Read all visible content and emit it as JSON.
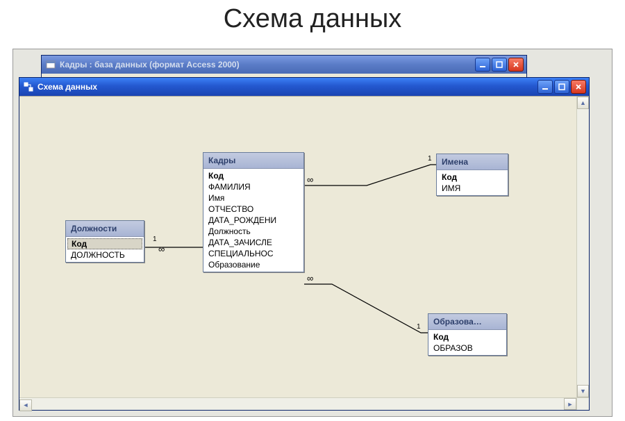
{
  "page_title": "Схема данных",
  "back_window": {
    "title": "Кадры : база данных (формат Access 2000)"
  },
  "front_window": {
    "title": "Схема данных"
  },
  "tables": {
    "dolzhnosti": {
      "title": "Должности",
      "fields": [
        "Код",
        "ДОЛЖНОСТЬ"
      ]
    },
    "kadry": {
      "title": "Кадры",
      "fields": [
        "Код",
        "ФАМИЛИЯ",
        "Имя",
        "ОТЧЕСТВО",
        "ДАТА_РОЖДЕНИ",
        "Должность",
        "ДАТА_ЗАЧИСЛЕ",
        "СПЕЦИАЛЬНОС",
        "Образование"
      ]
    },
    "imena": {
      "title": "Имена",
      "fields": [
        "Код",
        "ИМЯ"
      ]
    },
    "obrazova": {
      "title": "Образова…",
      "fields": [
        "Код",
        "ОБРАЗОВ"
      ]
    }
  },
  "relations": {
    "r1": {
      "left_card": "1",
      "right_card": "∞"
    },
    "r2": {
      "left_card": "∞",
      "right_card": "1"
    },
    "r3": {
      "left_card": "∞",
      "right_card": "1"
    }
  }
}
